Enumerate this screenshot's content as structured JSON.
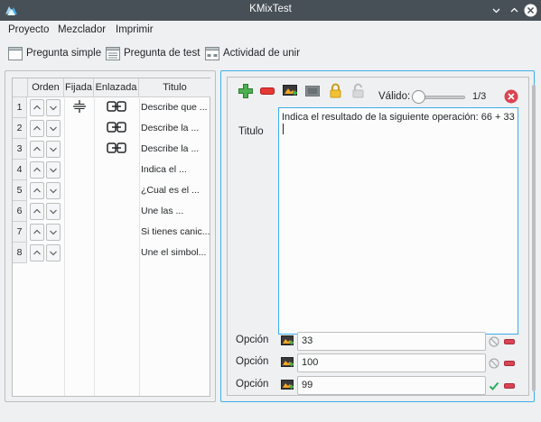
{
  "window": {
    "title": "KMixTest"
  },
  "menu": {
    "items": [
      "Proyecto",
      "Mezclador",
      "Imprimir"
    ]
  },
  "toolbar": {
    "simple_label": "Pregunta simple",
    "test_label": "Pregunta de test",
    "join_label": "Actividad de unir"
  },
  "table": {
    "headers": {
      "orden": "Orden",
      "fijada": "Fijada",
      "enlazada": "Enlazada",
      "titulo": "Titulo"
    },
    "rows": [
      {
        "num": "1",
        "pinned": true,
        "linked": true,
        "title": "Describe que ..."
      },
      {
        "num": "2",
        "pinned": false,
        "linked": true,
        "title": "Describe la ..."
      },
      {
        "num": "3",
        "pinned": false,
        "linked": true,
        "title": "Describe la ..."
      },
      {
        "num": "4",
        "pinned": false,
        "linked": false,
        "title": "Indica el ..."
      },
      {
        "num": "5",
        "pinned": false,
        "linked": false,
        "title": "¿Cual es el ..."
      },
      {
        "num": "6",
        "pinned": false,
        "linked": false,
        "title": "Une las ..."
      },
      {
        "num": "7",
        "pinned": false,
        "linked": false,
        "title": "Si tienes canic..."
      },
      {
        "num": "8",
        "pinned": false,
        "linked": false,
        "title": "Une el simbol..."
      }
    ]
  },
  "editor": {
    "valido_label": "Válido:",
    "valido_level": 0.0,
    "slider_value": "1/3",
    "titulo_label": "Titulo",
    "titulo_text": "Indica el resultado de la siguiente operación: 66 + 33",
    "option_label": "Opción",
    "options": [
      {
        "value": "33",
        "status": "invalid"
      },
      {
        "value": "100",
        "status": "invalid"
      },
      {
        "value": "99",
        "status": "valid"
      }
    ]
  },
  "colors": {
    "accent": "#3daee9",
    "titlebar": "#475057",
    "remove": "#da4453",
    "add": "#27ae60",
    "valid": "#27ae60"
  }
}
